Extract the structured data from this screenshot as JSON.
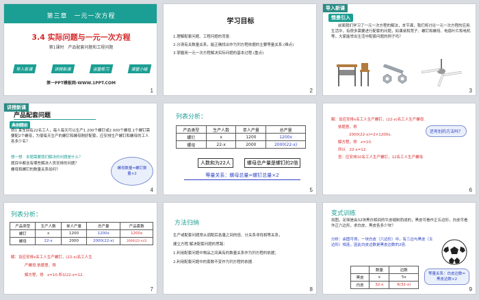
{
  "slides": [
    {
      "num": "1",
      "chapter": "第三章　一元一次方程",
      "title": "3.4 实际问题与一元一次方程",
      "subtitle": "第1课时　产品配套问题和工程问题",
      "nav": [
        "导入新课",
        "讲授新课",
        "当堂练习",
        "课堂小结"
      ],
      "footer": "第一PPT模板网-WWW.1PPT.COM"
    },
    {
      "num": "2",
      "heading": "学习目标",
      "items": [
        "1.理解配套问题、工程问题的背景.",
        "2.分清有关数量关系，能正确找出作为列方程依据的主要等量关系.(难点)",
        "3.掌握用一元一次方程解决实际问题的基本过程.(重点)"
      ]
    },
    {
      "num": "3",
      "tag": "导入新课",
      "label": "情景引入",
      "text": "前面我们学习了一元一次方程的解法，本节课，我们将讨论一元一次方程的应用.生活中，有很多需要进行配套的问题，如课桌和凳子、螺钉和螺母、电扇叶片和电机等，大家能举出生活中配套问题的例子吗？"
    },
    {
      "num": "4",
      "tag": "讲授新课",
      "heading": "产品配套问题",
      "label": "典例精析",
      "example": "例1 某车间有22名工人，每人每天可以生产1 200个螺钉或2 000个螺母.1个螺钉需要配2个螺母，为使每天生产的螺钉和螺母刚好配套，应安排生产螺钉和螺母的工人各多少名？",
      "step": "想一想　本题需要我们解决的问题是什么？",
      "q1": "题目中都含有哪些解决人员安排的问题？",
      "q2": "螺母和螺钉的数量关系如何？",
      "cloud": "螺母数量=螺钉数量×2"
    },
    {
      "num": "5",
      "heading": "列表分析：",
      "table": [
        [
          "产品类型",
          "生产人数",
          "单人产量",
          "总产量"
        ],
        [
          "螺钉",
          "x",
          "1200",
          "1200x"
        ],
        [
          "螺母",
          "22-x",
          "2000",
          "2000(22-x)"
        ]
      ],
      "box1": "人数和为22人",
      "box2": "螺母总产量是螺钉的2倍",
      "relation": "等量关系：螺母总量=螺钉总量×2"
    },
    {
      "num": "6",
      "lines": [
        "解：设应安排x名工人生产螺钉，(22-x)名工人生产螺母.",
        "依题意，得",
        "2000(22-x)=2×1200x.",
        "解方程，得　x=10.",
        "所以　22-x=12.",
        "答：应安排10名工人生产螺钉，12名工人生产螺母."
      ],
      "callout": "还有别的方法吗？"
    },
    {
      "num": "7",
      "heading": "列表分析：",
      "table": [
        [
          "产品类型",
          "生产人数",
          "单人产量",
          "总产量",
          "产品套数"
        ],
        [
          "螺钉",
          "x",
          "1200",
          "1200x",
          "1200x"
        ],
        [
          "螺母",
          "22-x",
          "2000",
          "2000(22-x)",
          "2000(22-x)/2"
        ]
      ],
      "sol1": "解：设应安排x名工人生产螺钉，(22-x)名工人生",
      "sol2": "产螺母.依题意，得",
      "sol3": "解方程，得　x=10.所以22-x=12."
    },
    {
      "num": "8",
      "heading": "方法归纳",
      "lines": [
        "生产或配套问题常从调配后各量之间的倍、分关系寻找相等关系，",
        "建立方程.解决配套问题的思路：",
        "1.利用配套问题中物品之间具有的数量关系作为列方程的依据；",
        "2.利用配套问题中的套数不变作为列方程的依据."
      ]
    },
    {
      "num": "9",
      "heading": "变式训练",
      "text": "如图，足球是由32块黑白相间的牛皮缝制而成的，黑皮可看作正五边形，白皮可看作正六边形，求白皮，黑皮各多少块？",
      "analysis": "分析：由图可得，一块白皮（六边形）中，有三边与黑皮（五边形）相连，因此白皮边数是黑皮边数的2倍.",
      "table": [
        [
          "",
          "数量",
          "边数"
        ],
        [
          "黑皮",
          "x",
          "5x"
        ],
        [
          "白皮",
          "32-x",
          "6(32-x)"
        ]
      ],
      "callout": "等量关系：白皮边数=黑皮边数×2"
    }
  ],
  "colors": {
    "teal": "#1b9e93",
    "red": "#d62a2a",
    "blue": "#2a3fc4",
    "green": "#2e9b3a"
  }
}
